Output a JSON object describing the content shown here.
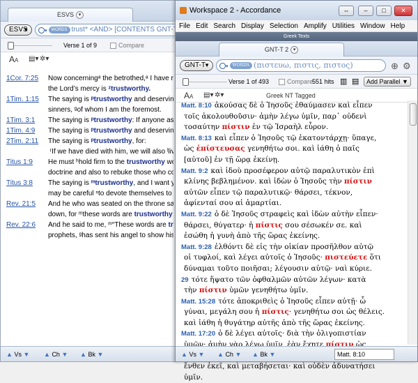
{
  "back_window": {
    "tab_label": "ESVS",
    "module": "ESVS",
    "search_badge": "WORDS",
    "search_text": "trust* <AND> [CONTENTS GNT-T",
    "verse_info": "Verse 1 of 9",
    "compare": "Compare",
    "text_size_label": "A",
    "lines": [
      {
        "ref": "1Cor. 7:25",
        "parts": [
          [
            "Now concerning",
            ""
          ],
          [
            "ᵃ the betrothed,ᵃ I have r",
            ""
          ]
        ]
      },
      {
        "ref": "",
        "parts": [
          [
            "the Lord’s mercy is ",
            ""
          ],
          [
            "ᶻtrustworthy.",
            "hl"
          ]
        ]
      },
      {
        "ref": "1Tim. 1:15",
        "parts": [
          [
            "The saying is ",
            ""
          ],
          [
            "ᵖtrustworthy",
            "hl"
          ],
          [
            " and deserving",
            ""
          ]
        ]
      },
      {
        "ref": "",
        "parts": [
          [
            "sinners, ",
            ""
          ],
          [
            "ᵍof whom I am the foremost.",
            ""
          ]
        ]
      },
      {
        "ref": "1Tim. 3:1",
        "parts": [
          [
            "The saying is ",
            ""
          ],
          [
            "ᵖtrustworthy",
            "hl"
          ],
          [
            ": If anyone aspi",
            ""
          ]
        ]
      },
      {
        "ref": "1Tim. 4:9",
        "parts": [
          [
            "The saying is ",
            ""
          ],
          [
            "ᵖtrustworthy",
            "hl"
          ],
          [
            " and deserving o",
            ""
          ]
        ]
      },
      {
        "ref": "2Tim. 2:11",
        "parts": [
          [
            "The saying is ",
            ""
          ],
          [
            "ᵖtrustworthy",
            "hl"
          ],
          [
            ", for:",
            ""
          ]
        ]
      },
      {
        "ref": "",
        "parts": [
          [
            "     ʳIf we have died with him, we will also ˡlive with",
            ""
          ]
        ]
      },
      {
        "ref": "Titus 1:9",
        "parts": [
          [
            "He must ",
            ""
          ],
          [
            "ʰhold firm to the ",
            ""
          ],
          [
            "trustworthy",
            "hl"
          ],
          [
            " word",
            ""
          ]
        ]
      },
      {
        "ref": "",
        "parts": [
          [
            "doctrine and also to rebuke those who contradict it.",
            ""
          ]
        ]
      },
      {
        "ref": "Titus 3:8",
        "parts": [
          [
            "The saying is ",
            ""
          ],
          [
            "ᵐtrustworthy",
            "hl"
          ],
          [
            ", and I want you",
            ""
          ]
        ]
      },
      {
        "ref": "",
        "parts": [
          [
            "may be careful ",
            ""
          ],
          [
            "ⁿto devote themselves to good works.",
            ""
          ]
        ]
      },
      {
        "ref": "Rev. 21:5",
        "parts": [
          [
            "And he who was seated on the throne said",
            ""
          ]
        ]
      },
      {
        "ref": "",
        "parts": [
          [
            "down, for ",
            ""
          ],
          [
            "ᵐthese words are ",
            ""
          ],
          [
            "trustworthy",
            "hl"
          ],
          [
            " and true.”",
            ""
          ]
        ]
      },
      {
        "ref": "Rev. 22:6",
        "parts": [
          [
            "And he said to me, ",
            ""
          ],
          [
            "ᵐ“These words are ",
            ""
          ],
          [
            "trust",
            "hl"
          ]
        ]
      },
      {
        "ref": "",
        "parts": [
          [
            "prophets, ",
            ""
          ],
          [
            "ᵍhas sent his angel to show his servants wh",
            ""
          ]
        ]
      }
    ],
    "footer": {
      "vs": "Vs",
      "ch": "Ch",
      "bk": "Bk"
    }
  },
  "front_window": {
    "title": "Workspace 2 - Accordance",
    "menu": [
      "File",
      "Edit",
      "Search",
      "Display",
      "Selection",
      "Amplify",
      "Utilities",
      "Window",
      "Help"
    ],
    "panel_title": "Greek Texts",
    "tab_label": "GNT-T 2",
    "module": "GNT-T",
    "search_badge": "WORDS",
    "search_text": "(πιστευω, πιστις, πιστος)",
    "verse_info": "Verse 1 of 493",
    "compare": "Compare",
    "hits": "551 hits",
    "add_parallel": "Add Parallel",
    "tagged_label": "Greek NT Tagged",
    "lines": [
      {
        "ref": "Matt. 8:10",
        "parts": [
          [
            "ἀκούσας δὲ ὁ Ἰησοῦς ἐθαύμασεν καὶ εἶπεν",
            ""
          ]
        ]
      },
      {
        "ref": "",
        "parts": [
          [
            "τοῖς ἀκολουθοῦσιν· ἀμὴν λέγω ὑμῖν, παρ᾽ οὐδενὶ",
            ""
          ]
        ]
      },
      {
        "ref": "",
        "parts": [
          [
            "τοσαύτην ",
            ""
          ],
          [
            "πίστιν",
            "gr"
          ],
          [
            " ἐν τῷ Ἰσραὴλ εὗρον.",
            ""
          ]
        ]
      },
      {
        "ref": "Matt. 8:13",
        "parts": [
          [
            "καὶ εἶπεν ὁ Ἰησοῦς τῷ ἑκατοντάρχῃ· ὕπαγε,",
            ""
          ]
        ]
      },
      {
        "ref": "",
        "parts": [
          [
            "ὡς ",
            ""
          ],
          [
            "ἐπίστευσας",
            "gr"
          ],
          [
            " γενηθήτω σοι. καὶ ἰάθη ὁ παῖς",
            ""
          ]
        ]
      },
      {
        "ref": "",
        "parts": [
          [
            "[αὐτοῦ] ἐν τῇ ὥρᾳ ἐκείνῃ.",
            ""
          ]
        ]
      },
      {
        "ref": "Matt. 9:2",
        "parts": [
          [
            "καὶ ἰδοὺ προσέφερον αὐτῷ παραλυτικὸν ἐπὶ",
            ""
          ]
        ]
      },
      {
        "ref": "",
        "parts": [
          [
            "κλίνης βεβλημένον. καὶ ἰδὼν ὁ Ἰησοῦς τὴν ",
            ""
          ],
          [
            "πίστιν",
            "gr"
          ]
        ]
      },
      {
        "ref": "",
        "parts": [
          [
            "αὐτῶν εἶπεν τῷ παραλυτικῷ· θάρσει, τέκνον,",
            ""
          ]
        ]
      },
      {
        "ref": "",
        "parts": [
          [
            "ἀφίενταί σου αἱ ἁμαρτίαι.",
            ""
          ]
        ]
      },
      {
        "ref": "Matt. 9:22",
        "parts": [
          [
            "ὁ δὲ Ἰησοῦς στραφεὶς καὶ ἰδὼν αὐτὴν εἶπεν·",
            ""
          ]
        ]
      },
      {
        "ref": "",
        "parts": [
          [
            "θάρσει, θύγατερ· ἡ ",
            ""
          ],
          [
            "πίστις",
            "gr"
          ],
          [
            " σου σέσωκέν σε. καὶ",
            ""
          ]
        ]
      },
      {
        "ref": "",
        "parts": [
          [
            "ἐσώθη ἡ γυνὴ ἀπὸ τῆς ὥρας ἐκείνης.",
            ""
          ]
        ]
      },
      {
        "ref": "Matt. 9:28",
        "parts": [
          [
            "ἐλθόντι δὲ εἰς τὴν οἰκίαν προσῆλθον αὐτῷ",
            ""
          ]
        ]
      },
      {
        "ref": "",
        "parts": [
          [
            "οἱ τυφλοί, καὶ λέγει αὐτοῖς ὁ Ἰησοῦς· ",
            ""
          ],
          [
            "πιστεύετε",
            "gr"
          ],
          [
            " ὅτι",
            ""
          ]
        ]
      },
      {
        "ref": "",
        "parts": [
          [
            "δύναμαι τοῦτο ποιῆσαι; λέγουσιν αὐτῷ· ναὶ κύριε.",
            ""
          ]
        ]
      },
      {
        "ref": "29",
        "parts": [
          [
            "τότε ἥψατο τῶν ὀφθαλμῶν αὐτῶν λέγων· κατὰ",
            ""
          ]
        ]
      },
      {
        "ref": "",
        "parts": [
          [
            "τὴν ",
            ""
          ],
          [
            "πίστιν",
            "gr"
          ],
          [
            " ὑμῶν γενηθήτω ὑμῖν.",
            ""
          ]
        ]
      },
      {
        "ref": "Matt. 15:28",
        "parts": [
          [
            "τότε ἀποκριθεὶς ὁ Ἰησοῦς εἶπεν αὐτῇ· ὦ",
            ""
          ]
        ]
      },
      {
        "ref": "",
        "parts": [
          [
            "γύναι, μεγάλη σου ἡ ",
            ""
          ],
          [
            "πίστις",
            "gr"
          ],
          [
            "· γενηθήτω σοι ὡς θέλεις.",
            ""
          ]
        ]
      },
      {
        "ref": "",
        "parts": [
          [
            "καὶ ἰάθη ἡ θυγάτηρ αὐτῆς ἀπὸ τῆς ὥρας ἐκείνης.",
            ""
          ]
        ]
      },
      {
        "ref": "Matt. 17:20",
        "parts": [
          [
            "ὁ δὲ λέγει αὐτοῖς· διὰ τὴν ὀλιγοπιστίαν",
            ""
          ]
        ]
      },
      {
        "ref": "",
        "parts": [
          [
            "ὑμῶν· ἀμὴν γὰρ λέγω ὑμῖν, ἐὰν ἔχητε ",
            ""
          ],
          [
            "πίστιν",
            "gr"
          ],
          [
            " ὡς",
            ""
          ]
        ]
      },
      {
        "ref": "",
        "parts": [
          [
            "κόκκον σινάπεως, ἐρεῖτε τῷ ὄρει τούτῳ· μετάβα",
            ""
          ]
        ]
      },
      {
        "ref": "",
        "parts": [
          [
            "ἔνθεν ἐκεῖ, καὶ μεταβήσεται· καὶ οὐδὲν ἀδυνατήσει",
            ""
          ]
        ]
      },
      {
        "ref": "",
        "parts": [
          [
            "ὑμῖν.",
            ""
          ]
        ]
      }
    ],
    "footer": {
      "vs": "Vs",
      "ch": "Ch",
      "bk": "Bk",
      "goto": "Matt. 8:10"
    }
  }
}
